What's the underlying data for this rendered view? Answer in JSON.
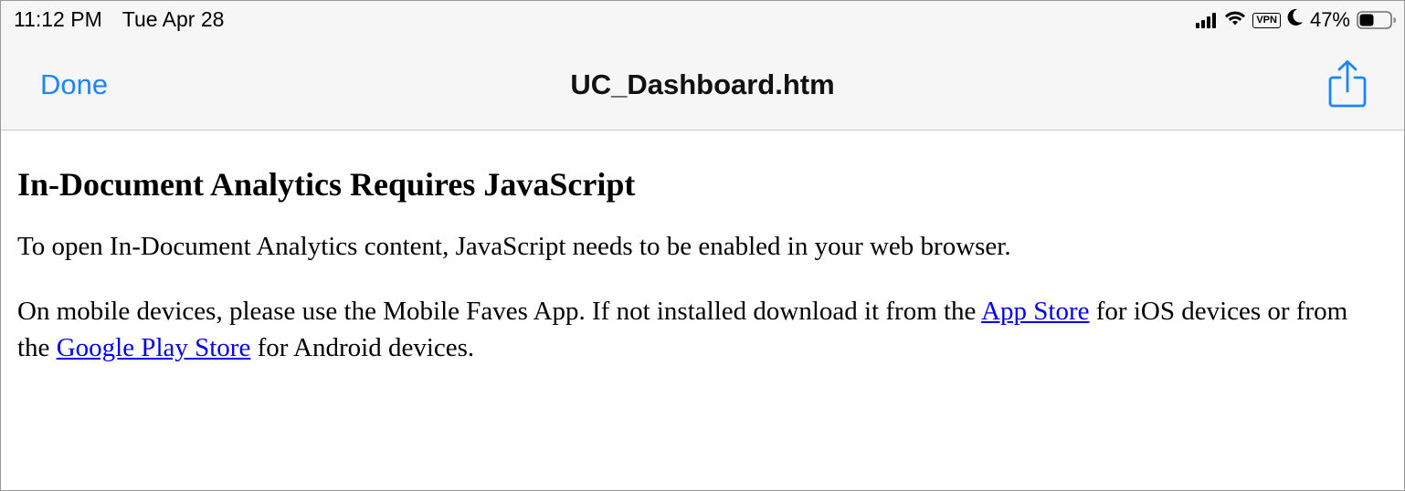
{
  "status_bar": {
    "time": "11:12 PM",
    "date": "Tue Apr 28",
    "vpn_label": "VPN",
    "battery": "47%",
    "battery_level": 0.47,
    "icons": [
      "cellular-signal-icon",
      "wifi-icon",
      "vpn-icon",
      "do-not-disturb-moon-icon",
      "battery-icon"
    ]
  },
  "nav_bar": {
    "done_label": "Done",
    "title": "UC_Dashboard.htm",
    "share_icon": "share-icon"
  },
  "document": {
    "heading": "In-Document Analytics Requires JavaScript",
    "para1": "To open In-Document Analytics content, JavaScript needs to be enabled in your web browser.",
    "para2_before": "On mobile devices, please use the Mobile Faves App. If not installed download it from the ",
    "app_store_link": "App Store",
    "para2_middle": " for iOS devices or from the ",
    "google_play_link": "Google Play Store",
    "para2_after": " for Android devices."
  },
  "colors": {
    "accent": "#1a85ff",
    "link": "#0000ee",
    "bar_background": "#f6f6f6"
  }
}
